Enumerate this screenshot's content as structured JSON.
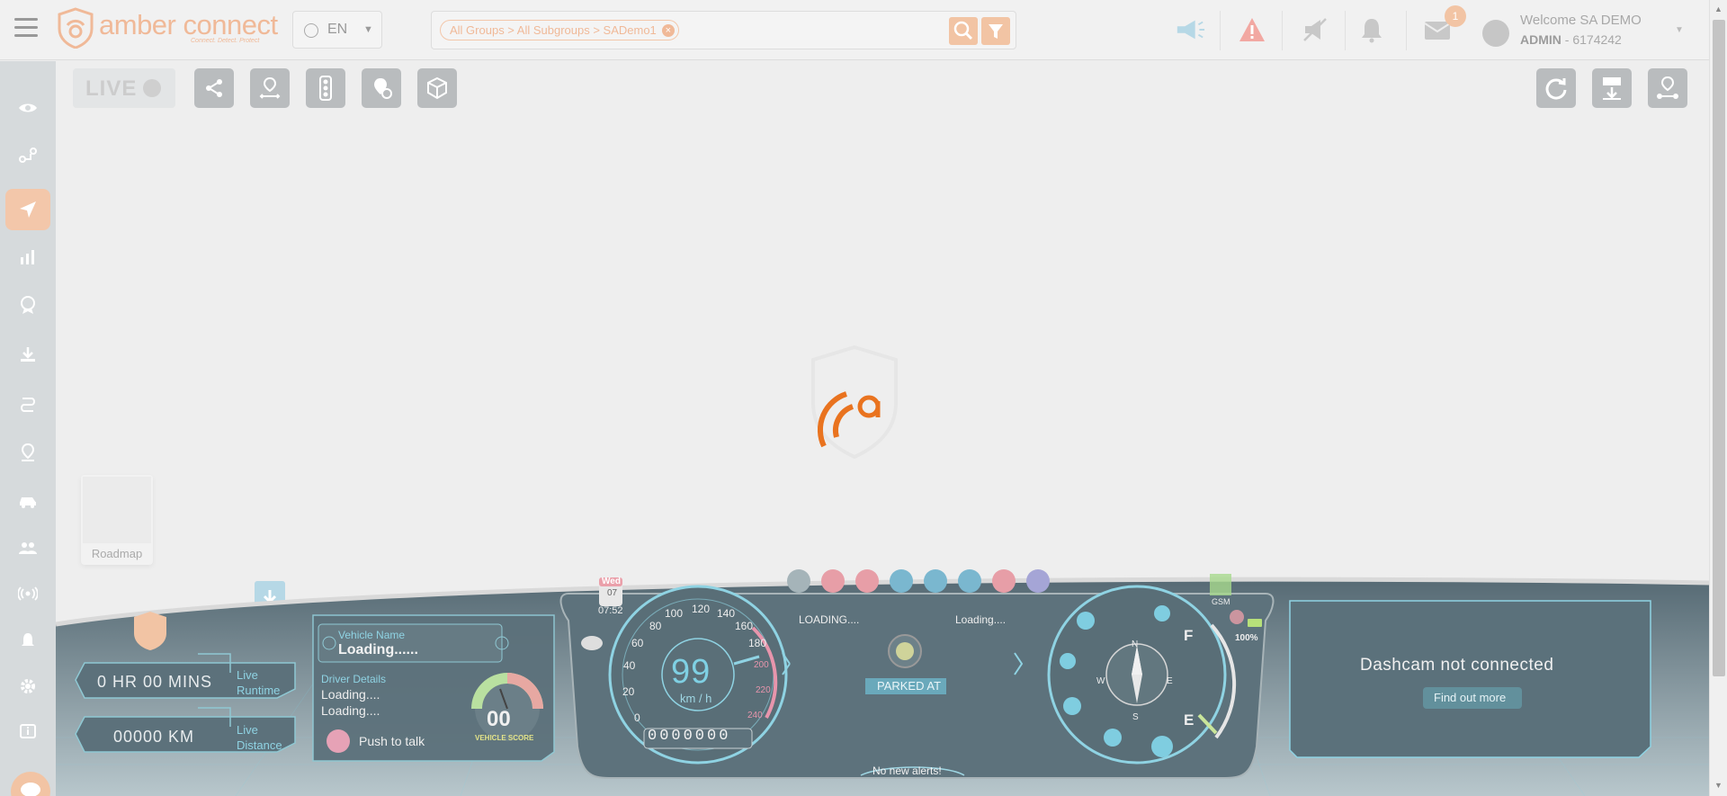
{
  "header": {
    "logo_text": "amber connect",
    "logo_tagline": "Connect. Detect. Protect",
    "language": "EN",
    "search_chip": "All Groups > All Subgroups > SADemo1",
    "notification_count": "1",
    "welcome": "Welcome SA DEMO",
    "role": "ADMIN",
    "account_id": " - 6174242"
  },
  "toolbar": {
    "live_label": "LIVE"
  },
  "map": {
    "layer_label": "Roadmap"
  },
  "dashboard": {
    "runtime": "0 HR 00 MINS",
    "runtime_label_1": "Live",
    "runtime_label_2": "Runtime",
    "distance": "00000 KM",
    "distance_label_1": "Live",
    "distance_label_2": "Distance",
    "vehicle_name_label": "Vehicle Name",
    "vehicle_name": "Loading......",
    "driver_details_label": "Driver Details",
    "driver_line_1": "Loading....",
    "driver_line_2": "Loading....",
    "push_to_talk": "Push to talk",
    "vehicle_score": "00",
    "vehicle_score_label": "VEHICLE SCORE",
    "day": "Wed",
    "date": "07",
    "time": "07:52",
    "speed": "99",
    "speed_unit": "km / h",
    "odometer": "0000000",
    "speed_ticks": [
      "0",
      "20",
      "40",
      "60",
      "80",
      "100",
      "120",
      "140",
      "160",
      "180",
      "200",
      "220",
      "240"
    ],
    "status_loading_1": "LOADING....",
    "status_loading_2": "Loading....",
    "parked": "PARKED AT",
    "alerts": "No new alerts!",
    "gsm": "GSM",
    "battery": "100%",
    "compass": [
      "N",
      "E",
      "S",
      "W"
    ],
    "fuel_full": "F",
    "fuel_empty": "E",
    "dashcam_title": "Dashcam not connected",
    "dashcam_link": "Find out more"
  },
  "colors": {
    "accent": "#f0b998",
    "hud_cyan": "#58c6dd",
    "hud_dark": "#4d6470",
    "sidebar": "#d6dadc"
  }
}
